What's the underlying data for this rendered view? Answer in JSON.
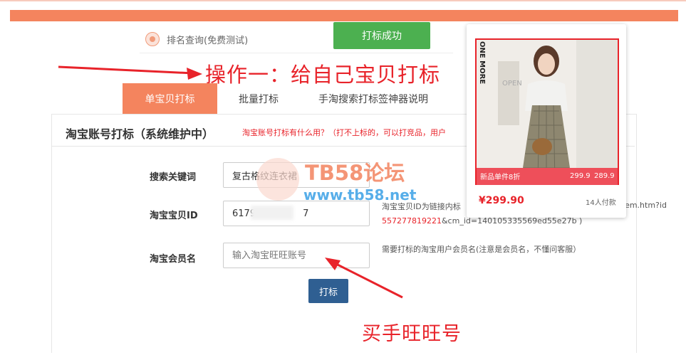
{
  "header": {
    "rank_query": "排名查询(免费测试)",
    "success_button": "打标成功"
  },
  "annotations": {
    "step_one": "操作一：给自己宝贝打标",
    "buyer_account": "买手旺旺号"
  },
  "tabs": [
    {
      "label": "单宝贝打标",
      "active": true
    },
    {
      "label": "批量打标",
      "active": false
    },
    {
      "label": "手淘搜索打标签神器说明",
      "active": false
    }
  ],
  "panel": {
    "title": "淘宝账号打标（系统维护中）",
    "hint": "淘宝账号打标有什么用？（打不上标的，可以打竞品，用户"
  },
  "form": {
    "keyword_label": "搜索关键词",
    "keyword_value": "复古格纹连衣裙",
    "item_id_label": "淘宝宝贝ID",
    "item_id_value": "6179",
    "item_id_value_tail": "7",
    "item_id_help_line1": "淘宝宝贝ID为链接内标",
    "item_id_help_url": "/item.htm?id",
    "item_id_help_red": "557277819221",
    "item_id_help_line2": "&cm_id=140105335569ed55e27b )",
    "member_label": "淘宝会员名",
    "member_placeholder": "输入淘宝旺旺账号",
    "member_help": "需要打标的淘宝用户会员名(注意是会员名，不懂问客服）",
    "submit_label": "打标"
  },
  "watermark": {
    "name": "TB58论坛",
    "url": "www.tb58.net"
  },
  "product_card": {
    "brand": "ONE MORE",
    "shop_sign": "OPEN",
    "strip_text": "新品单件8折",
    "price_1": "299.9",
    "price_2": "289.9",
    "price": "¥299.90",
    "sold": "14人付款"
  },
  "colors": {
    "accent": "#f4845e",
    "success": "#4cb050",
    "primary_button": "#2f5f92",
    "annotation": "#e8232a"
  }
}
